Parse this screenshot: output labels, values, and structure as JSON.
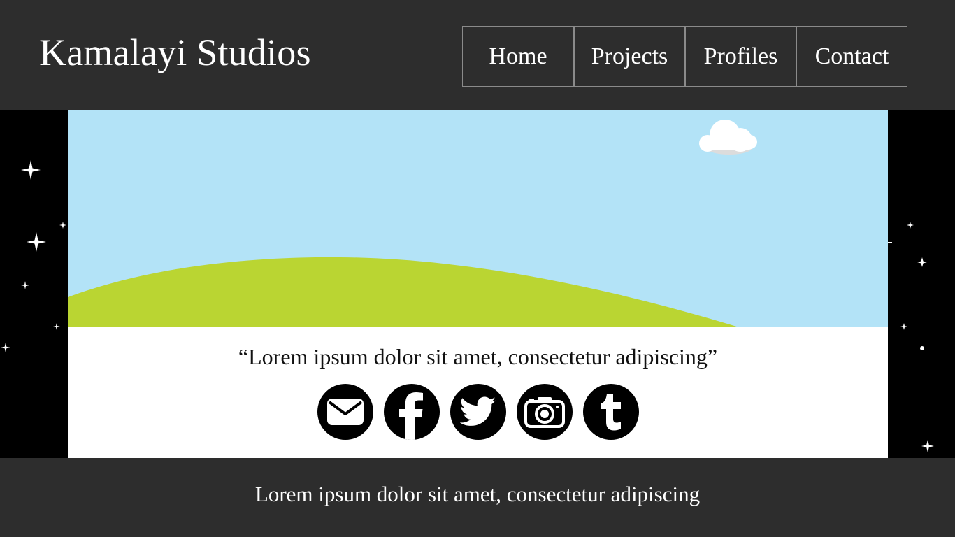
{
  "header": {
    "brand": "Kamalayi Studios",
    "nav": [
      {
        "label": "Home"
      },
      {
        "label": "Projects"
      },
      {
        "label": "Profiles"
      },
      {
        "label": "Contact"
      }
    ]
  },
  "hero": {
    "quote": "“Lorem ipsum dolor sit amet, consectetur adipiscing”",
    "social": [
      {
        "icon": "email-icon"
      },
      {
        "icon": "facebook-icon"
      },
      {
        "icon": "twitter-icon"
      },
      {
        "icon": "camera-icon"
      },
      {
        "icon": "tumblr-icon"
      }
    ]
  },
  "footer": {
    "text": "Lorem ipsum dolor sit amet, consectetur adipiscing"
  },
  "colors": {
    "header_bg": "#2d2d2d",
    "sky": "#b3e3f7",
    "hill": "#bad532",
    "space": "#000000"
  }
}
